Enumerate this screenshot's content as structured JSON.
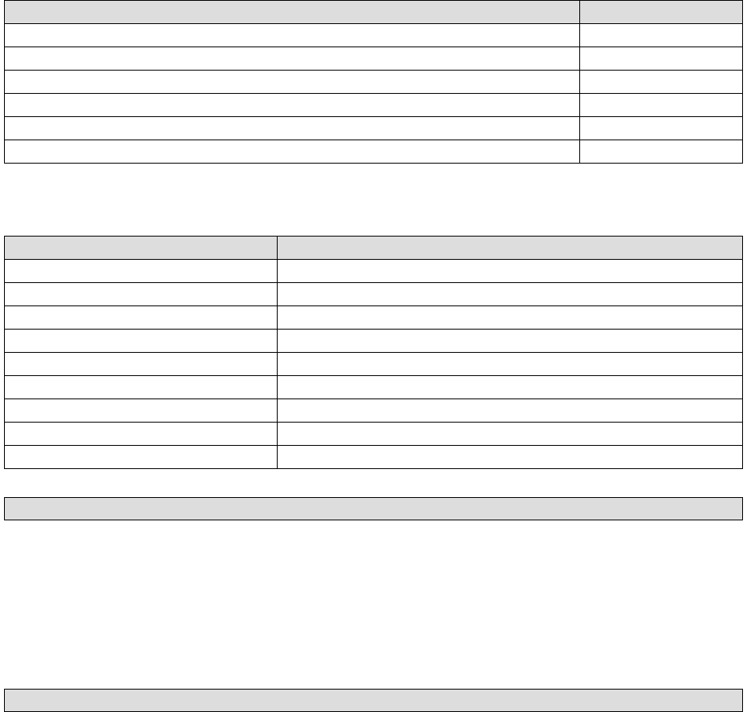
{
  "table1": {
    "headers": [
      "",
      ""
    ],
    "rows": [
      [
        "",
        ""
      ],
      [
        "",
        ""
      ],
      [
        "",
        ""
      ],
      [
        "",
        ""
      ],
      [
        "",
        ""
      ],
      [
        "",
        ""
      ]
    ]
  },
  "table2": {
    "headers": [
      "",
      ""
    ],
    "rows": [
      [
        "",
        ""
      ],
      [
        "",
        ""
      ],
      [
        "",
        ""
      ],
      [
        "",
        ""
      ],
      [
        "",
        ""
      ],
      [
        "",
        ""
      ],
      [
        "",
        ""
      ],
      [
        "",
        ""
      ],
      [
        "",
        ""
      ]
    ]
  },
  "bar1": {
    "label": ""
  },
  "bar2": {
    "label": ""
  }
}
